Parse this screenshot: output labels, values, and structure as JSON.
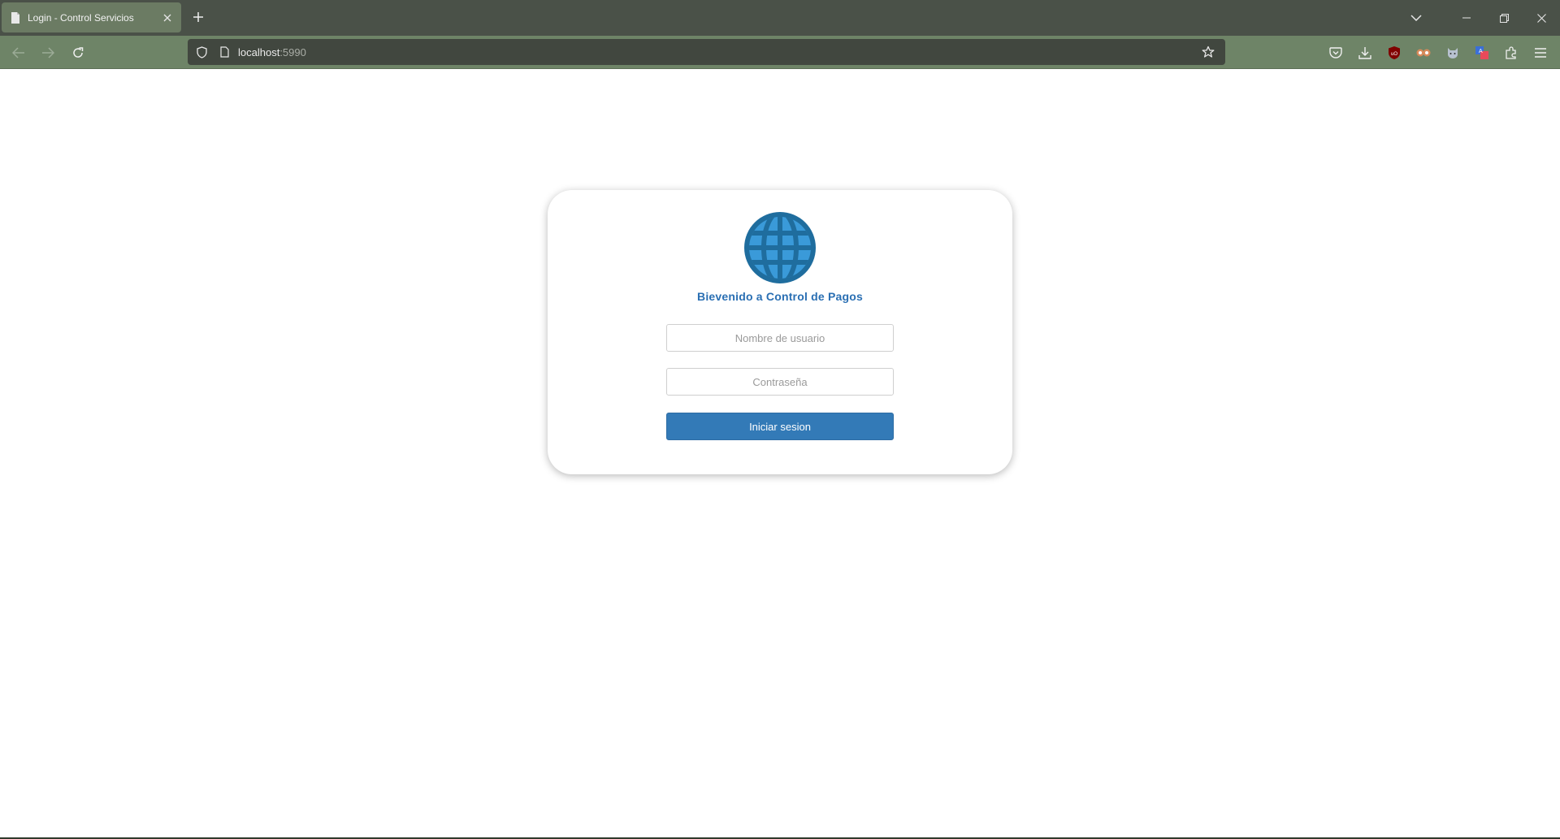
{
  "browser": {
    "tab": {
      "title": "Login - Control Servicios",
      "icon": "document-icon"
    },
    "url": {
      "host": "localhost",
      "port": ":5990"
    },
    "colors": {
      "tabbar": "#4a5148",
      "toolbar": "#6e8467",
      "urlbar": "#41473f",
      "active_tab": "#6b7b63"
    },
    "toolbar_icons": [
      "back-arrow-icon",
      "forward-arrow-icon",
      "reload-icon",
      "shield-icon",
      "page-icon",
      "star-icon",
      "pocket-icon",
      "download-icon",
      "ublock-icon",
      "extension-eyes-icon",
      "extension-cat-icon",
      "extension-translate-icon",
      "extensions-puzzle-icon",
      "menu-icon"
    ]
  },
  "login": {
    "heading": "Bievenido a Control de Pagos",
    "username_placeholder": "Nombre de usuario",
    "password_placeholder": "Contraseña",
    "submit_label": "Iniciar sesion",
    "logo_icon": "globe-icon",
    "colors": {
      "accent": "#337ab7",
      "heading": "#2a6fb3",
      "globe": "#3a9ad9"
    }
  }
}
